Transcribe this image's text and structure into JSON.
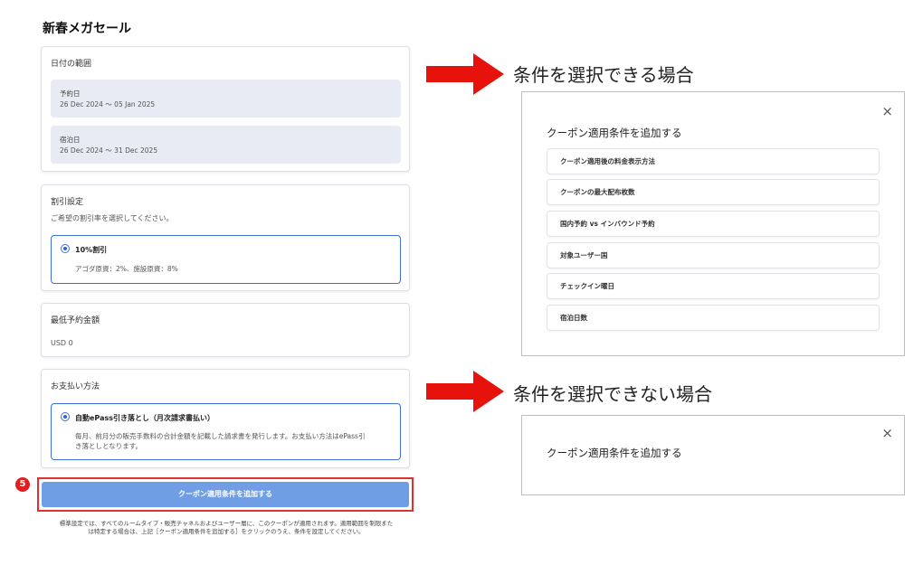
{
  "page": {
    "title": "新春メガセール"
  },
  "date_range": {
    "label": "日付の範囲",
    "booking": {
      "label": "予約日",
      "value": "26 Dec 2024 ～ 05 Jan 2025"
    },
    "stay": {
      "label": "宿泊日",
      "value": "26 Dec 2024 ～ 31 Dec 2025"
    }
  },
  "discount": {
    "label": "割引設定",
    "hint": "ご希望の割引率を選択してください。",
    "option_title": "10%割引",
    "option_desc": "アゴダ原資：2%、施設原資：8%"
  },
  "min_amount": {
    "label": "最低予約金額",
    "value": "USD 0"
  },
  "payment": {
    "label": "お支払い方法",
    "option_title": "自動ePass引き落とし（月次請求書払い）",
    "option_desc_1": "毎月、前月分の販売手数料の合計金額を記載した請求書を発行します。お支払い方法はePass引",
    "option_desc_2": "き落としとなります。"
  },
  "cta": {
    "label": "クーポン適用条件を追加する",
    "step_number": "5"
  },
  "footer": {
    "line1": "標準設定では、すべてのルームタイプ・販売チャネルおよびユーザー層に、このクーポンが適用されます。適用範囲を制限また",
    "line2": "は特定する場合は、上記［クーポン適用条件を追加する］をクリックのうえ、条件を設定してください。"
  },
  "annotations": {
    "selectable": "条件を選択できる場合",
    "not_selectable": "条件を選択できない場合",
    "arrow_color": "#e8120c"
  },
  "panel_selectable": {
    "title": "クーポン適用条件を追加する",
    "close_icon": "×",
    "items": [
      "クーポン適用後の料金表示方法",
      "クーポンの最大配布枚数",
      "国内予約 vs インバウンド予約",
      "対象ユーザー国",
      "チェックイン曜日",
      "宿泊日数"
    ]
  },
  "panel_not_selectable": {
    "title": "クーポン適用条件を追加する",
    "close_icon": "×"
  }
}
